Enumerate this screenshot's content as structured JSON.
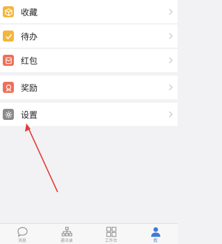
{
  "menu": {
    "group1": [
      {
        "label": "收藏",
        "icon": "box-icon",
        "color": "#f3b63d"
      },
      {
        "label": "待办",
        "icon": "checkmark-icon",
        "color": "#f3b63d"
      },
      {
        "label": "红包",
        "icon": "red-envelope-icon",
        "color": "#ee7059"
      }
    ],
    "group2": [
      {
        "label": "奖励",
        "icon": "award-icon",
        "color": "#ee7059"
      }
    ],
    "group3": [
      {
        "label": "设置",
        "icon": "gear-icon",
        "color": "#8a8a8a"
      }
    ]
  },
  "tabbar": [
    {
      "label": "消息",
      "icon": "chat-bubble-icon",
      "active": false
    },
    {
      "label": "通讯录",
      "icon": "org-chart-icon",
      "active": false
    },
    {
      "label": "工作台",
      "icon": "grid-icon",
      "active": false
    },
    {
      "label": "我",
      "icon": "person-icon",
      "active": true
    }
  ],
  "colors": {
    "accent": "#3d7bd6",
    "annotation_arrow": "#e53935"
  }
}
